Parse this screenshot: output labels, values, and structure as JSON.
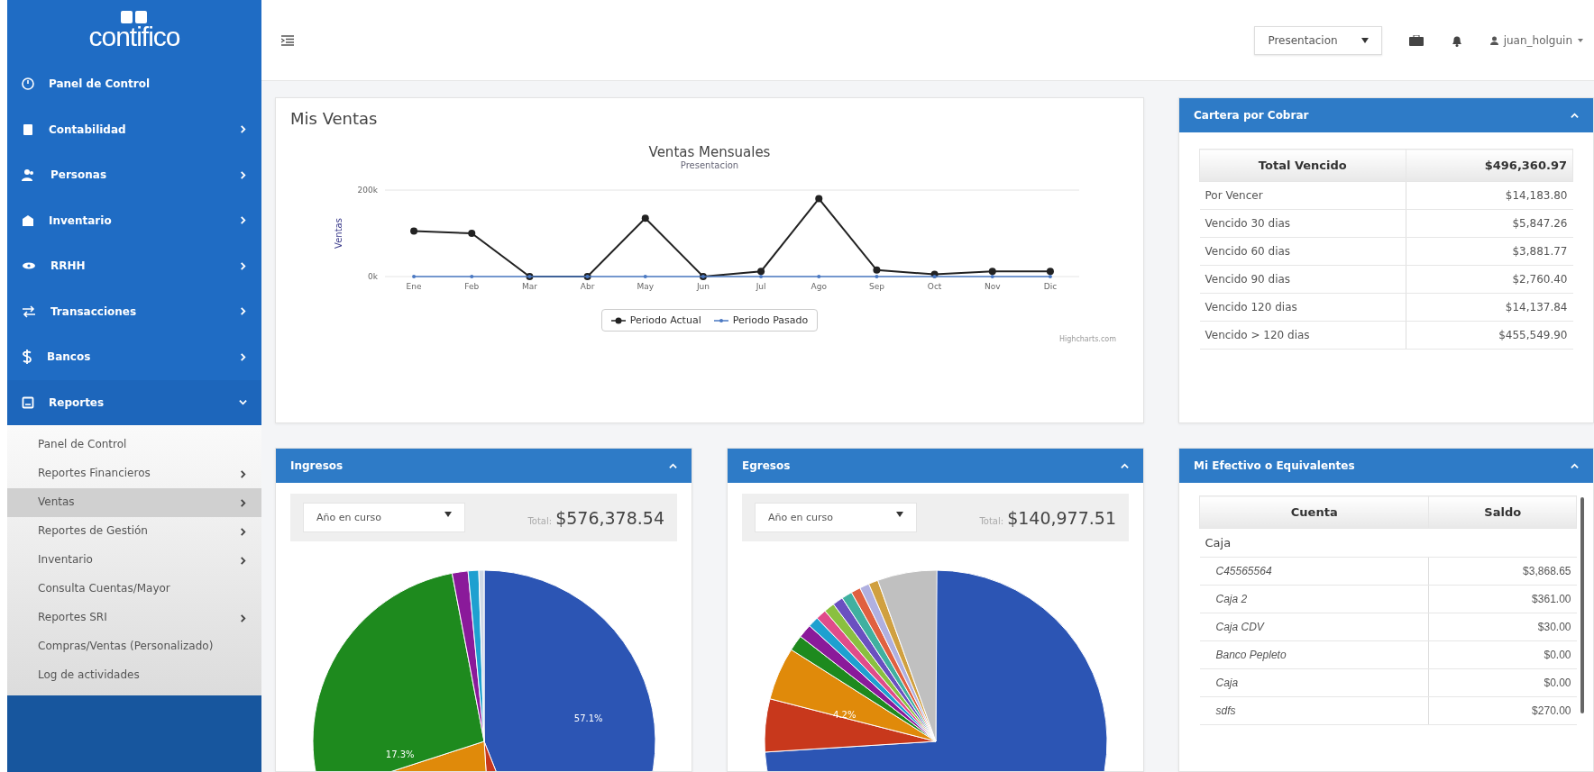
{
  "sidebar": {
    "logo": "contifico",
    "items": [
      {
        "label": "Panel de Control",
        "kind": "link"
      },
      {
        "label": "Contabilidad",
        "kind": "menu",
        "expanded": false
      },
      {
        "label": "Personas",
        "kind": "menu",
        "expanded": false
      },
      {
        "label": "Inventario",
        "kind": "menu",
        "expanded": false
      },
      {
        "label": "RRHH",
        "kind": "menu",
        "expanded": false
      },
      {
        "label": "Transacciones",
        "kind": "menu",
        "expanded": false
      },
      {
        "label": "Bancos",
        "kind": "menu",
        "expanded": false
      },
      {
        "label": "Reportes",
        "kind": "menu",
        "expanded": true
      }
    ],
    "submenu": [
      {
        "label": "Panel de Control",
        "kind": "link",
        "selected": false
      },
      {
        "label": "Reportes Financieros",
        "kind": "menu",
        "selected": false
      },
      {
        "label": "Ventas",
        "kind": "menu",
        "selected": true
      },
      {
        "label": "Reportes de Gestión",
        "kind": "menu",
        "selected": false
      },
      {
        "label": "Inventario",
        "kind": "menu",
        "selected": false
      },
      {
        "label": "Consulta Cuentas/Mayor",
        "kind": "link",
        "selected": false
      },
      {
        "label": "Reportes SRI",
        "kind": "menu",
        "selected": false
      },
      {
        "label": "Compras/Ventas (Personalizado)",
        "kind": "link",
        "selected": false
      },
      {
        "label": "Log de actividades",
        "kind": "link",
        "selected": false
      }
    ]
  },
  "topbar": {
    "company_select": "Presentacion",
    "user": "juan_holguin"
  },
  "sales": {
    "title": "Mis Ventas",
    "credits": "Highcharts.com",
    "chart_data": {
      "type": "line",
      "title": "Ventas Mensuales",
      "subtitle": "Presentacion",
      "ylabel": "Ventas",
      "categories": [
        "Ene",
        "Feb",
        "Mar",
        "Abr",
        "May",
        "Jun",
        "Jul",
        "Ago",
        "Sep",
        "Oct",
        "Nov",
        "Dic"
      ],
      "series": [
        {
          "name": "Periodo Actual",
          "color": "#222222",
          "marker": true,
          "values": [
            105000,
            100000,
            0,
            0,
            135000,
            0,
            12000,
            180000,
            15000,
            5000,
            12000,
            12000
          ]
        },
        {
          "name": "Periodo Pasado",
          "color": "#4a78c2",
          "marker": true,
          "values": [
            0,
            0,
            0,
            0,
            0,
            0,
            0,
            0,
            0,
            0,
            0,
            0
          ]
        }
      ],
      "ylim": [
        0,
        200000
      ],
      "yticks": [
        {
          "value": 0,
          "label": "0k"
        },
        {
          "value": 200000,
          "label": "200k"
        }
      ]
    }
  },
  "receivables": {
    "title": "Cartera por Cobrar",
    "header": [
      "Total Vencido",
      "$496,360.97"
    ],
    "rows": [
      [
        "Por Vencer",
        "$14,183.80"
      ],
      [
        "Vencido 30 dias",
        "$5,847.26"
      ],
      [
        "Vencido 60 dias",
        "$3,881.77"
      ],
      [
        "Vencido 90 dias",
        "$2,760.40"
      ],
      [
        "Vencido 120 dias",
        "$14,137.84"
      ],
      [
        "Vencido > 120 dias",
        "$455,549.90"
      ]
    ]
  },
  "income": {
    "title": "Ingresos",
    "period": "Año en curso",
    "total_label": "Total:",
    "total": "$576,378.54",
    "kind": "income",
    "slice_labels": [
      "57.1%",
      "17.3%"
    ]
  },
  "expenses": {
    "title": "Egresos",
    "period": "Año en curso",
    "total_label": "Total:",
    "total": "$140,977.51",
    "kind": "expense",
    "slice_labels": [
      "4.2%"
    ]
  },
  "cash": {
    "title": "Mi Efectivo o Equivalentes",
    "columns": [
      "Cuenta",
      "Saldo"
    ],
    "groups": [
      {
        "name": "Caja",
        "rows": [
          [
            "C45565564",
            "$3,868.65"
          ],
          [
            "Caja 2",
            "$361.00"
          ],
          [
            "Caja CDV",
            "$30.00"
          ],
          [
            "Banco Pepleto",
            "$0.00"
          ],
          [
            "Caja",
            "$0.00"
          ],
          [
            "sdfs",
            "$270.00"
          ]
        ]
      }
    ]
  }
}
